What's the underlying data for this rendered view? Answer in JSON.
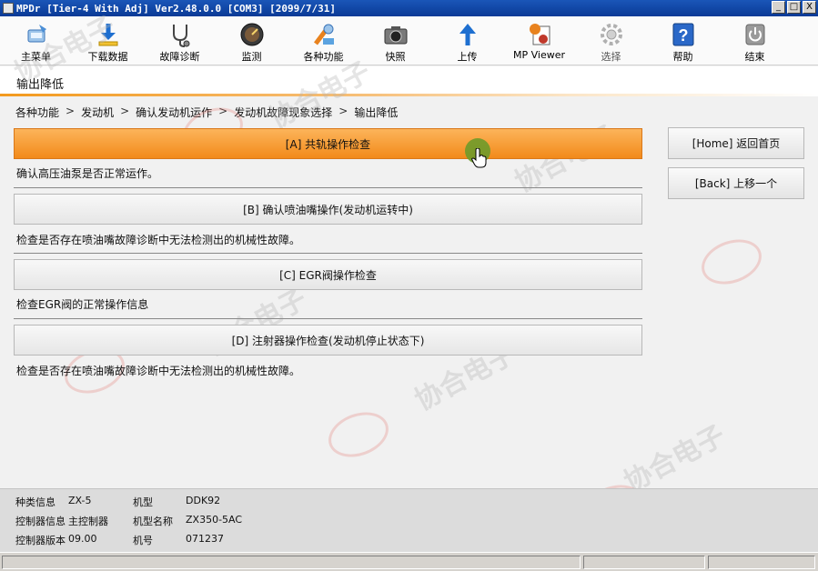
{
  "window": {
    "title": "MPDr [Tier-4 With Adj] Ver2.48.0.0 [COM3] [2099/7/31]",
    "buttons": {
      "minimize": "_",
      "maximize": "□",
      "close": "X"
    }
  },
  "toolbar": [
    {
      "label": "主菜单",
      "icon": "main-menu-icon"
    },
    {
      "label": "下载数据",
      "icon": "download-icon"
    },
    {
      "label": "故障诊断",
      "icon": "stethoscope-icon"
    },
    {
      "label": "监测",
      "icon": "gauge-icon"
    },
    {
      "label": "各种功能",
      "icon": "tools-icon"
    },
    {
      "label": "快照",
      "icon": "camera-icon"
    },
    {
      "label": "上传",
      "icon": "upload-icon"
    },
    {
      "label": "MP Viewer",
      "icon": "mp-viewer-icon"
    },
    {
      "label": "选择",
      "icon": "gear-icon"
    },
    {
      "label": "帮助",
      "icon": "help-icon"
    },
    {
      "label": "结束",
      "icon": "power-icon"
    }
  ],
  "page": {
    "title": "输出降低",
    "breadcrumb": [
      "各种功能",
      "发动机",
      "确认发动机运作",
      "发动机故障现象选择",
      "输出降低"
    ],
    "breadcrumb_sep": ">"
  },
  "options": [
    {
      "label": "[A] 共轨操作检查",
      "desc": "确认高压油泵是否正常运作。"
    },
    {
      "label": "[B] 确认喷油嘴操作(发动机运转中)",
      "desc": "检查是否存在喷油嘴故障诊断中无法检测出的机械性故障。"
    },
    {
      "label": "[C] EGR阀操作检查",
      "desc": "检查EGR阀的正常操作信息"
    },
    {
      "label": "[D] 注射器操作检查(发动机停止状态下)",
      "desc": "检查是否存在喷油嘴故障诊断中无法检测出的机械性故障。"
    }
  ],
  "side": {
    "home": "[Home] 返回首页",
    "back": "[Back] 上移一个"
  },
  "info": {
    "r1": {
      "k1": "种类信息",
      "v1": "ZX-5",
      "k2": "机型",
      "v2": "DDK92"
    },
    "r2": {
      "k1": "控制器信息",
      "v1": "主控制器",
      "k2": "机型名称",
      "v2": "ZX350-5AC"
    },
    "r3": {
      "k1": "控制器版本",
      "v1": "09.00",
      "k2": "机号",
      "v2": "071237"
    }
  },
  "watermark": {
    "text": "协合电子",
    "logo_text": "协合电子"
  },
  "colors": {
    "accent": "#f28a1a",
    "titlebar": "#0a3a96"
  }
}
